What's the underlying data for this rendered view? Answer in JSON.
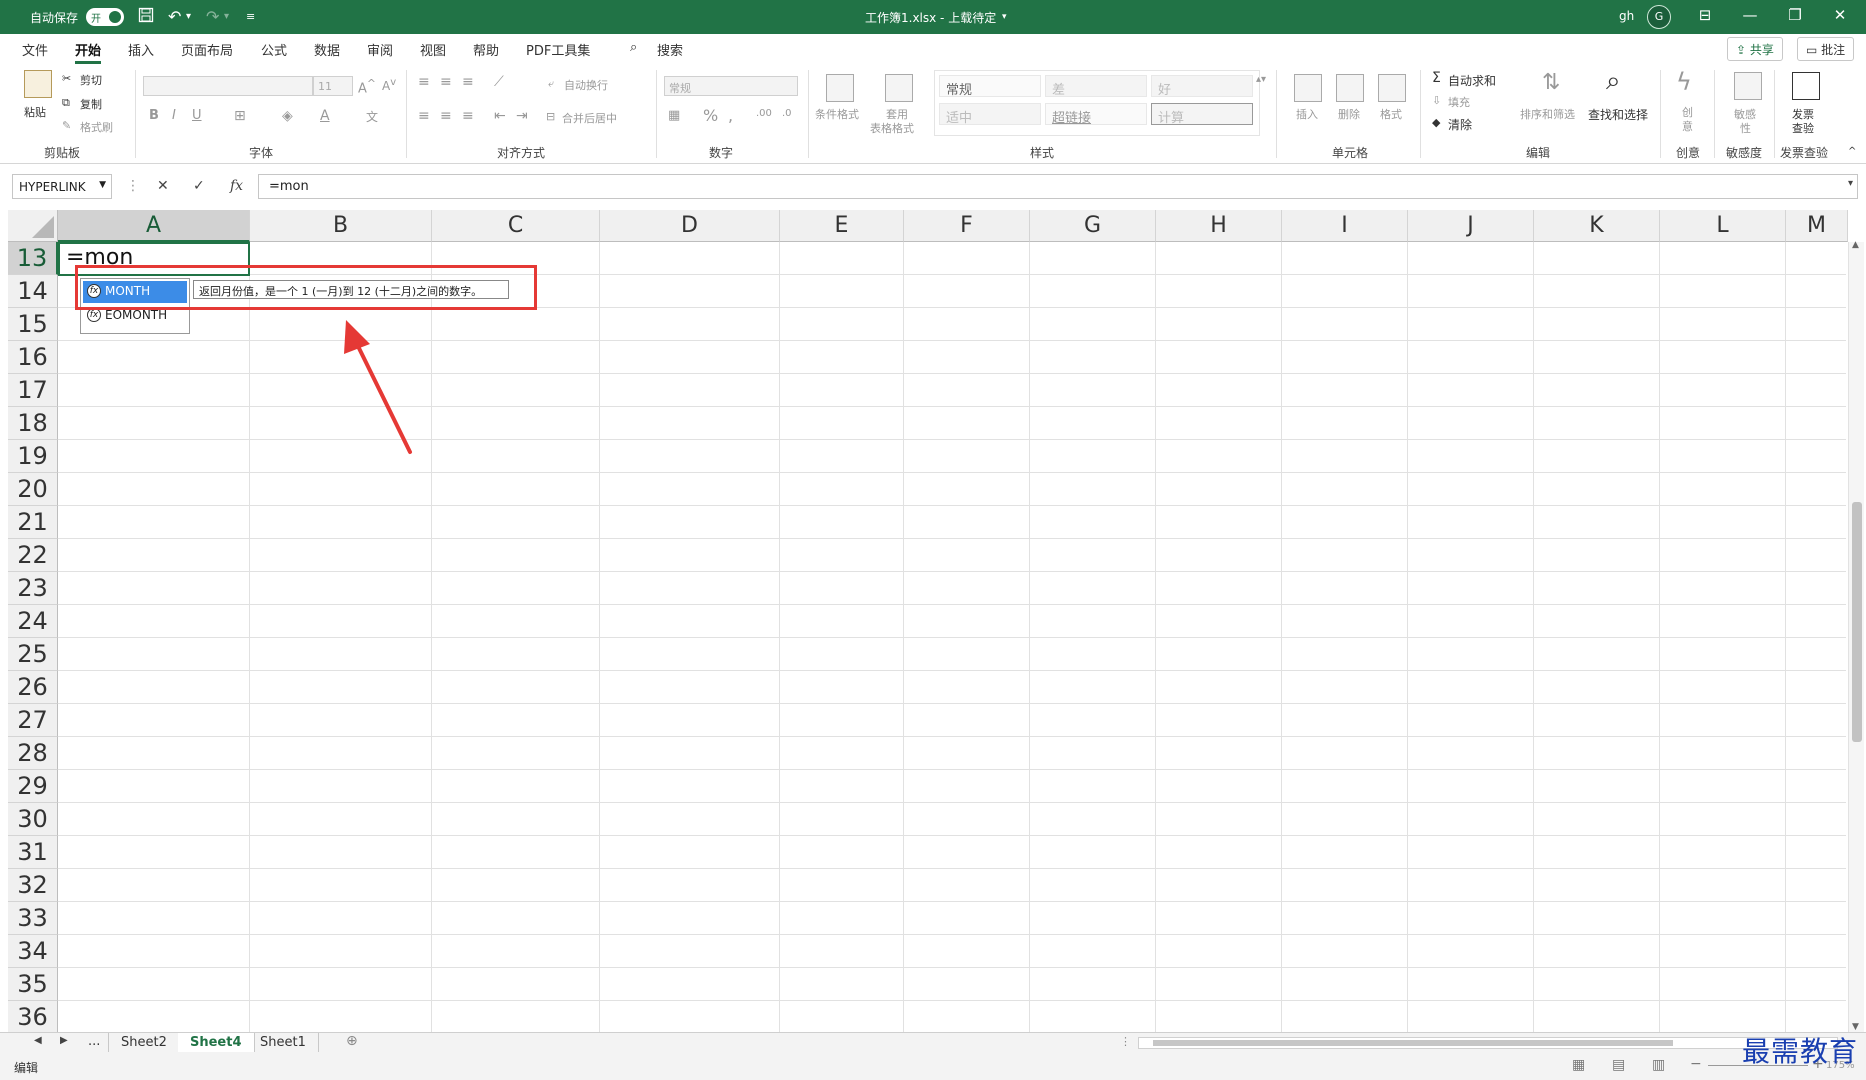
{
  "titlebar": {
    "autosave_label": "自动保存",
    "autosave_toggle": "开",
    "doc_title": "工作簿1.xlsx - 上载待定",
    "user": "gh",
    "avatar_initial": "G"
  },
  "menu": {
    "tabs": [
      "文件",
      "开始",
      "插入",
      "页面布局",
      "公式",
      "数据",
      "审阅",
      "视图",
      "帮助",
      "PDF工具集"
    ],
    "active_tab": "开始",
    "search_label": "搜索",
    "share_label": "共享",
    "comments_label": "批注"
  },
  "ribbon": {
    "clipboard": {
      "paste": "粘贴",
      "cut": "剪切",
      "copy": "复制",
      "format_painter": "格式刷",
      "label": "剪贴板"
    },
    "font": {
      "font_size": "11",
      "label": "字体"
    },
    "alignment": {
      "wrap": "自动换行",
      "merge": "合并后居中",
      "label": "对齐方式"
    },
    "number": {
      "format": "常规",
      "label": "数字"
    },
    "styles": {
      "cond_format": "条件格式",
      "table_format_1": "套用",
      "table_format_2": "表格格式",
      "cells": [
        "常规",
        "差",
        "好",
        "适中",
        "超链接",
        "计算"
      ],
      "label": "样式"
    },
    "cells": {
      "insert": "插入",
      "delete": "删除",
      "format": "格式",
      "label": "单元格"
    },
    "editing": {
      "autosum": "自动求和",
      "fill": "填充",
      "clear": "清除",
      "sort_filter": "排序和筛选",
      "find_select": "查找和选择",
      "label": "编辑"
    },
    "creative": {
      "btn_1": "创",
      "btn_2": "意",
      "label": "创意"
    },
    "sensitivity": {
      "btn_1": "敏感",
      "btn_2": "性",
      "label": "敏感度"
    },
    "invoice": {
      "btn_1": "发票",
      "btn_2": "查验",
      "label": "发票查验"
    }
  },
  "formula_bar": {
    "name_box": "HYPERLINK",
    "cancel_glyph": "✕",
    "enter_glyph": "✓",
    "fx_label": "fx",
    "formula": "=mon"
  },
  "grid": {
    "columns": [
      "A",
      "B",
      "C",
      "D",
      "E",
      "F",
      "G",
      "H",
      "I",
      "J",
      "K",
      "L",
      "M"
    ],
    "rows": [
      "13",
      "14",
      "15",
      "16",
      "17",
      "18",
      "19",
      "20",
      "21",
      "22",
      "23",
      "24",
      "25",
      "26",
      "27",
      "28",
      "29",
      "30",
      "31",
      "32",
      "33",
      "34",
      "35",
      "36"
    ],
    "active_column": "A",
    "active_row": "13",
    "active_cell_text": "=mon",
    "autocomplete": {
      "items": [
        "MONTH",
        "EOMONTH"
      ],
      "fx_glyph": "fx",
      "selected": "MONTH",
      "tooltip": "返回月份值，是一个 1 (一月)到 12 (十二月)之间的数字。"
    }
  },
  "sheets": {
    "nav_more": "...",
    "tabs": [
      "Sheet2",
      "Sheet4",
      "Sheet1"
    ],
    "active": "Sheet4"
  },
  "status": {
    "mode": "编辑",
    "zoom": "175%"
  },
  "watermark": "最需教育",
  "colors": {
    "excel_green": "#217346",
    "highlight_blue": "#3c8ce7",
    "annotation_red": "#e53935"
  }
}
